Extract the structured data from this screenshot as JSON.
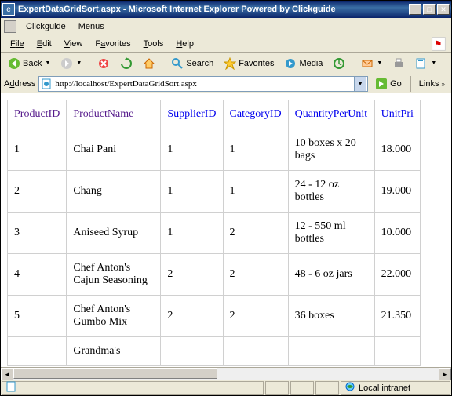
{
  "window": {
    "title": "ExpertDataGridSort.aspx - Microsoft Internet Explorer Powered by Clickguide"
  },
  "menubar1": {
    "app": "Clickguide",
    "menus": "Menus"
  },
  "filemenu": {
    "file": "File",
    "edit": "Edit",
    "view": "View",
    "favorites": "Favorites",
    "tools": "Tools",
    "help": "Help"
  },
  "toolbar": {
    "back": "Back",
    "search": "Search",
    "favorites": "Favorites",
    "media": "Media"
  },
  "address": {
    "label": "Address",
    "url": "http://localhost/ExpertDataGridSort.aspx",
    "go": "Go",
    "links": "Links"
  },
  "grid": {
    "headers": [
      "ProductID",
      "ProductName",
      "SupplierID",
      "CategoryID",
      "QuantityPerUnit",
      "UnitPri"
    ],
    "rows": [
      {
        "id": "1",
        "name": "Chai Pani",
        "sup": "1",
        "cat": "1",
        "qty": "10 boxes x 20 bags",
        "price": "18.000"
      },
      {
        "id": "2",
        "name": "Chang",
        "sup": "1",
        "cat": "1",
        "qty": "24 - 12 oz bottles",
        "price": "19.000"
      },
      {
        "id": "3",
        "name": "Aniseed Syrup",
        "sup": "1",
        "cat": "2",
        "qty": "12 - 550 ml bottles",
        "price": "10.000"
      },
      {
        "id": "4",
        "name": "Chef Anton's Cajun Seasoning",
        "sup": "2",
        "cat": "2",
        "qty": "48 - 6 oz jars",
        "price": "22.000"
      },
      {
        "id": "5",
        "name": "Chef Anton's Gumbo Mix",
        "sup": "2",
        "cat": "2",
        "qty": "36 boxes",
        "price": "21.350"
      },
      {
        "id": "",
        "name": "Grandma's",
        "sup": "",
        "cat": "",
        "qty": "",
        "price": ""
      }
    ]
  },
  "status": {
    "zone": "Local intranet"
  }
}
